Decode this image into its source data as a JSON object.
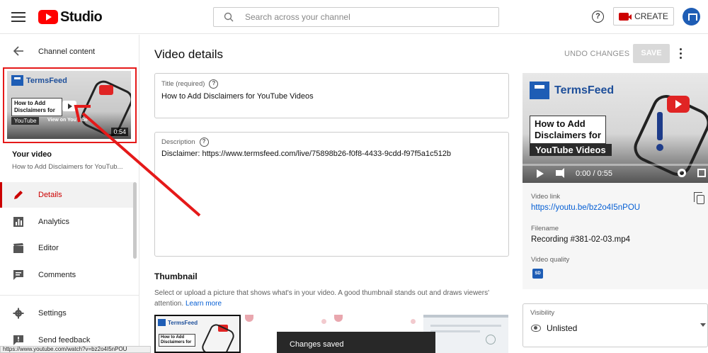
{
  "header": {
    "brand": "Studio",
    "search_placeholder": "Search across your channel",
    "create_label": "CREATE"
  },
  "sidebar": {
    "back_label": "Channel content",
    "thumbnail": {
      "brand": "TermsFeed",
      "title": "How to Add Disclaimers for",
      "yt_label": "YouTube",
      "view_label": "View on YouTube",
      "duration": "0:54"
    },
    "your_video_label": "Your video",
    "video_title": "How to Add Disclaimers for YouTub...",
    "nav": [
      {
        "label": "Details",
        "icon": "pencil-icon",
        "active": true
      },
      {
        "label": "Analytics",
        "icon": "analytics-icon",
        "active": false
      },
      {
        "label": "Editor",
        "icon": "editor-icon",
        "active": false
      },
      {
        "label": "Comments",
        "icon": "comments-icon",
        "active": false
      },
      {
        "label": "Settings",
        "icon": "gear-icon",
        "active": false
      },
      {
        "label": "Send feedback",
        "icon": "feedback-icon",
        "active": false
      }
    ]
  },
  "status_url": "https://www.youtube.com/watch?v=bz2o4I5nPOU",
  "main": {
    "title": "Video details",
    "undo_label": "UNDO CHANGES",
    "save_label": "SAVE",
    "title_field": {
      "label": "Title (required)",
      "value": "How to Add Disclaimers for YouTube Videos"
    },
    "description_field": {
      "label": "Description",
      "value": "Disclaimer: https://www.termsfeed.com/live/75898b26-f0f8-4433-9cdd-f97f5a1c512b"
    },
    "thumbnail_section": {
      "title": "Thumbnail",
      "description": "Select or upload a picture that shows what's in your video. A good thumbnail stands out and draws viewers' attention.",
      "learn_more": "Learn more"
    }
  },
  "toast": "Changes saved",
  "right_panel": {
    "player": {
      "brand": "TermsFeed",
      "title": "How to Add Disclaimers for",
      "yt_label": "YouTube Videos",
      "time": "0:00 / 0:55",
      "progress": 0
    },
    "video_link_label": "Video link",
    "video_link": "https://youtu.be/bz2o4I5nPOU",
    "filename_label": "Filename",
    "filename": "Recording #381-02-03.mp4",
    "quality_label": "Video quality",
    "quality_badge": "SD",
    "visibility_label": "Visibility",
    "visibility_value": "Unlisted"
  },
  "colors": {
    "brand_red": "#ff0000",
    "accent_blue": "#065fd4",
    "annotation_red": "#e51919"
  }
}
